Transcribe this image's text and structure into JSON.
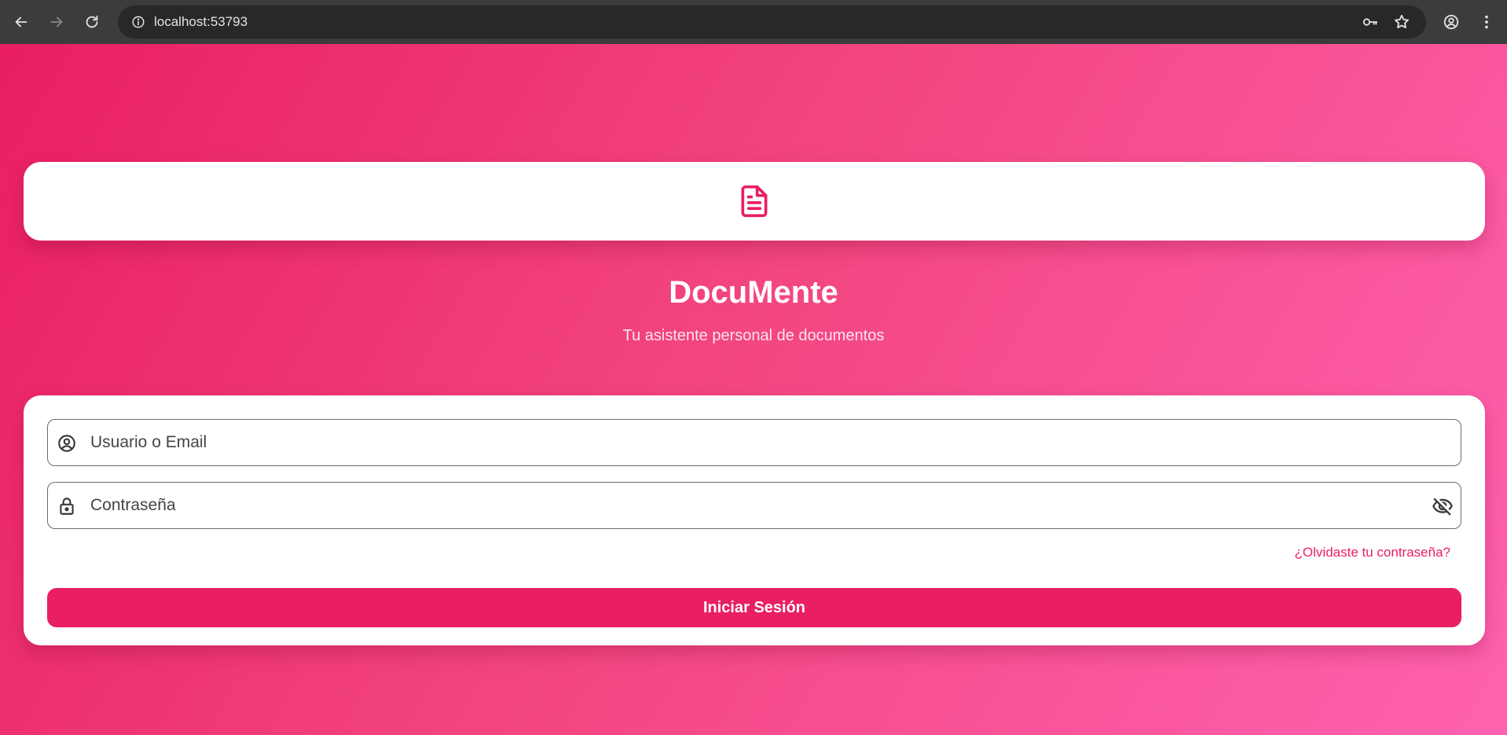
{
  "browser": {
    "url": "localhost:53793",
    "icons": {
      "back": "arrow-left-icon",
      "forward": "arrow-right-icon",
      "reload": "reload-icon",
      "site_info": "info-icon",
      "password": "key-icon",
      "bookmark": "star-icon",
      "profile": "account-circle-icon",
      "menu": "more-vert-icon"
    }
  },
  "app": {
    "logo_icon": "document-icon",
    "title": "DocuMente",
    "subtitle": "Tu asistente personal de documentos"
  },
  "login_form": {
    "username": {
      "placeholder": "Usuario o Email",
      "value": "",
      "icon": "account-circle-icon"
    },
    "password": {
      "placeholder": "Contraseña",
      "value": "",
      "icon": "lock-icon",
      "toggle_icon": "visibility-off-icon"
    },
    "forgot_link": "¿Olvidaste tu contraseña?",
    "submit_label": "Iniciar Sesión"
  },
  "colors": {
    "accent": "#e91e63",
    "gradient_start": "#e91e63",
    "gradient_end": "#ff62b0",
    "card": "#ffffff"
  }
}
